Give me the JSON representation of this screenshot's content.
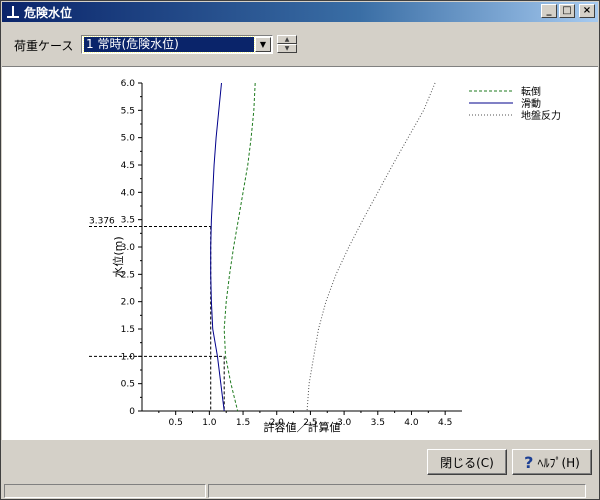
{
  "window": {
    "title": "危険水位",
    "min_glyph": "_",
    "max_glyph": "□",
    "close_glyph": "×"
  },
  "toolbar": {
    "load_case_label": "荷重ケース",
    "load_case_value": "1 常時(危険水位)",
    "dropdown_glyph": "▼",
    "spin_up": "▲",
    "spin_down": "▼"
  },
  "buttons": {
    "close_label": "閉じる(C)",
    "help_label": "ﾍﾙﾌﾟ(H)",
    "help_icon": "question-icon"
  },
  "chart_data": {
    "type": "line",
    "xlabel": "許容値／計算値",
    "ylabel": "水位(m)",
    "xlim": [
      0,
      4.75
    ],
    "ylim": [
      0,
      6.0
    ],
    "xticks": [
      "0.5",
      "1.0",
      "1.5",
      "2.0",
      "2.5",
      "3.0",
      "3.5",
      "4.0",
      "4.5"
    ],
    "yticks": [
      "0",
      "0.5",
      "1.0",
      "1.5",
      "2.0",
      "2.5",
      "3.0",
      "3.5",
      "4.0",
      "4.5",
      "5.0",
      "5.5",
      "6.0"
    ],
    "y_unlabeled_ticks": [
      0.25,
      0.75,
      1.25,
      1.75,
      2.25,
      2.75,
      3.25,
      3.75,
      4.25,
      4.75,
      5.25,
      5.75
    ],
    "x_unlabeled_ticks": [
      0.25,
      0.75,
      1.25,
      1.75,
      2.25,
      2.75,
      3.25,
      3.75,
      4.25
    ],
    "legend_position": "top-right",
    "annotations": [
      {
        "label": "3.376",
        "y": 3.376,
        "x": 1.02
      },
      {
        "label": "",
        "y": 1.0,
        "x": 1.22
      }
    ],
    "series": [
      {
        "name": "転倒",
        "color": "#1e7a1e",
        "dash": "3,2",
        "x": [
          1.68,
          1.66,
          1.62,
          1.57,
          1.5,
          1.43,
          1.36,
          1.3,
          1.25,
          1.22,
          1.24,
          1.32,
          1.42
        ],
        "y": [
          6.0,
          5.5,
          5.0,
          4.5,
          4.0,
          3.5,
          3.0,
          2.5,
          2.0,
          1.5,
          1.0,
          0.5,
          0.0
        ]
      },
      {
        "name": "滑動",
        "color": "#00008b",
        "dash": "",
        "x": [
          1.18,
          1.14,
          1.1,
          1.07,
          1.05,
          1.03,
          1.02,
          1.02,
          1.03,
          1.05,
          1.12,
          1.17,
          1.22
        ],
        "y": [
          6.0,
          5.5,
          5.0,
          4.5,
          4.0,
          3.5,
          3.0,
          2.5,
          2.0,
          1.5,
          1.0,
          0.5,
          0.0
        ]
      },
      {
        "name": "地盤反力",
        "color": "#505050",
        "dash": "1,2",
        "x": [
          4.35,
          4.18,
          3.95,
          3.72,
          3.5,
          3.28,
          3.07,
          2.88,
          2.73,
          2.62,
          2.55,
          2.48,
          2.45
        ],
        "y": [
          6.0,
          5.5,
          5.0,
          4.5,
          4.0,
          3.5,
          3.0,
          2.5,
          2.0,
          1.5,
          1.0,
          0.5,
          0.0
        ]
      }
    ]
  }
}
